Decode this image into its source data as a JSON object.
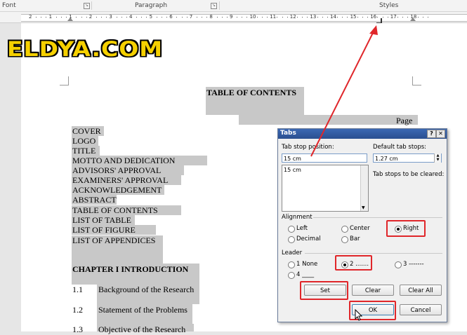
{
  "ribbon": {
    "groups": [
      "Font",
      "Paragraph",
      "Styles"
    ]
  },
  "ruler": {
    "numbers": [
      "2",
      "1",
      "1",
      "2",
      "3",
      "4",
      "5",
      "6",
      "7",
      "8",
      "9",
      "10",
      "11",
      "12",
      "13",
      "14",
      "15",
      "16",
      "17",
      "18"
    ],
    "tab_stop_at": "15"
  },
  "watermark": {
    "text": "ELDYA.COM"
  },
  "document": {
    "title": "TABLE OF CONTENTS",
    "page_label": "Page",
    "entries": [
      "COVER",
      "LOGO",
      "TITLE",
      "MOTTO AND DEDICATION",
      "ADVISORS' APPROVAL",
      "EXAMINERS' APPROVAL",
      "ACKNOWLEDGEMENT",
      "ABSTRACT",
      "TABLE OF CONTENTS",
      "LIST OF TABLE",
      "LIST OF FIGURE",
      "LIST OF APPENDICES"
    ],
    "chapter": "CHAPTER I INTRODUCTION",
    "subsections": [
      {
        "num": "1.1",
        "text": "Background of the Research"
      },
      {
        "num": "1.2",
        "text": "Statement of the Problems"
      },
      {
        "num": "1.3",
        "text": "Objective of the Research"
      }
    ]
  },
  "dialog": {
    "title": "Tabs",
    "help_label": "?",
    "close_label": "✕",
    "tab_stop_position_label": "Tab stop position:",
    "tab_stop_position_value": "15 cm",
    "default_tab_stops_label": "Default tab stops:",
    "default_tab_stops_value": "1.27 cm",
    "tab_stops_list": [
      "15 cm"
    ],
    "tab_stops_to_clear_label": "Tab stops to be cleared:",
    "alignment_label": "Alignment",
    "alignment_options": [
      {
        "label": "Left",
        "selected": false
      },
      {
        "label": "Center",
        "selected": false
      },
      {
        "label": "Right",
        "selected": true
      },
      {
        "label": "Decimal",
        "selected": false
      },
      {
        "label": "Bar",
        "selected": false
      }
    ],
    "leader_label": "Leader",
    "leader_options": [
      {
        "label": "1 None",
        "selected": false
      },
      {
        "label": "2 .......",
        "selected": true
      },
      {
        "label": "3 -------",
        "selected": false
      },
      {
        "label": "4 ____",
        "selected": false
      }
    ],
    "buttons": {
      "set": "Set",
      "clear": "Clear",
      "clear_all": "Clear All",
      "ok": "OK",
      "cancel": "Cancel"
    }
  },
  "colors": {
    "highlight": "#c8c8c8",
    "annotation_red": "#e0262a",
    "titlebar": "#2f5aa3",
    "logo_yellow": "#f5d000"
  }
}
